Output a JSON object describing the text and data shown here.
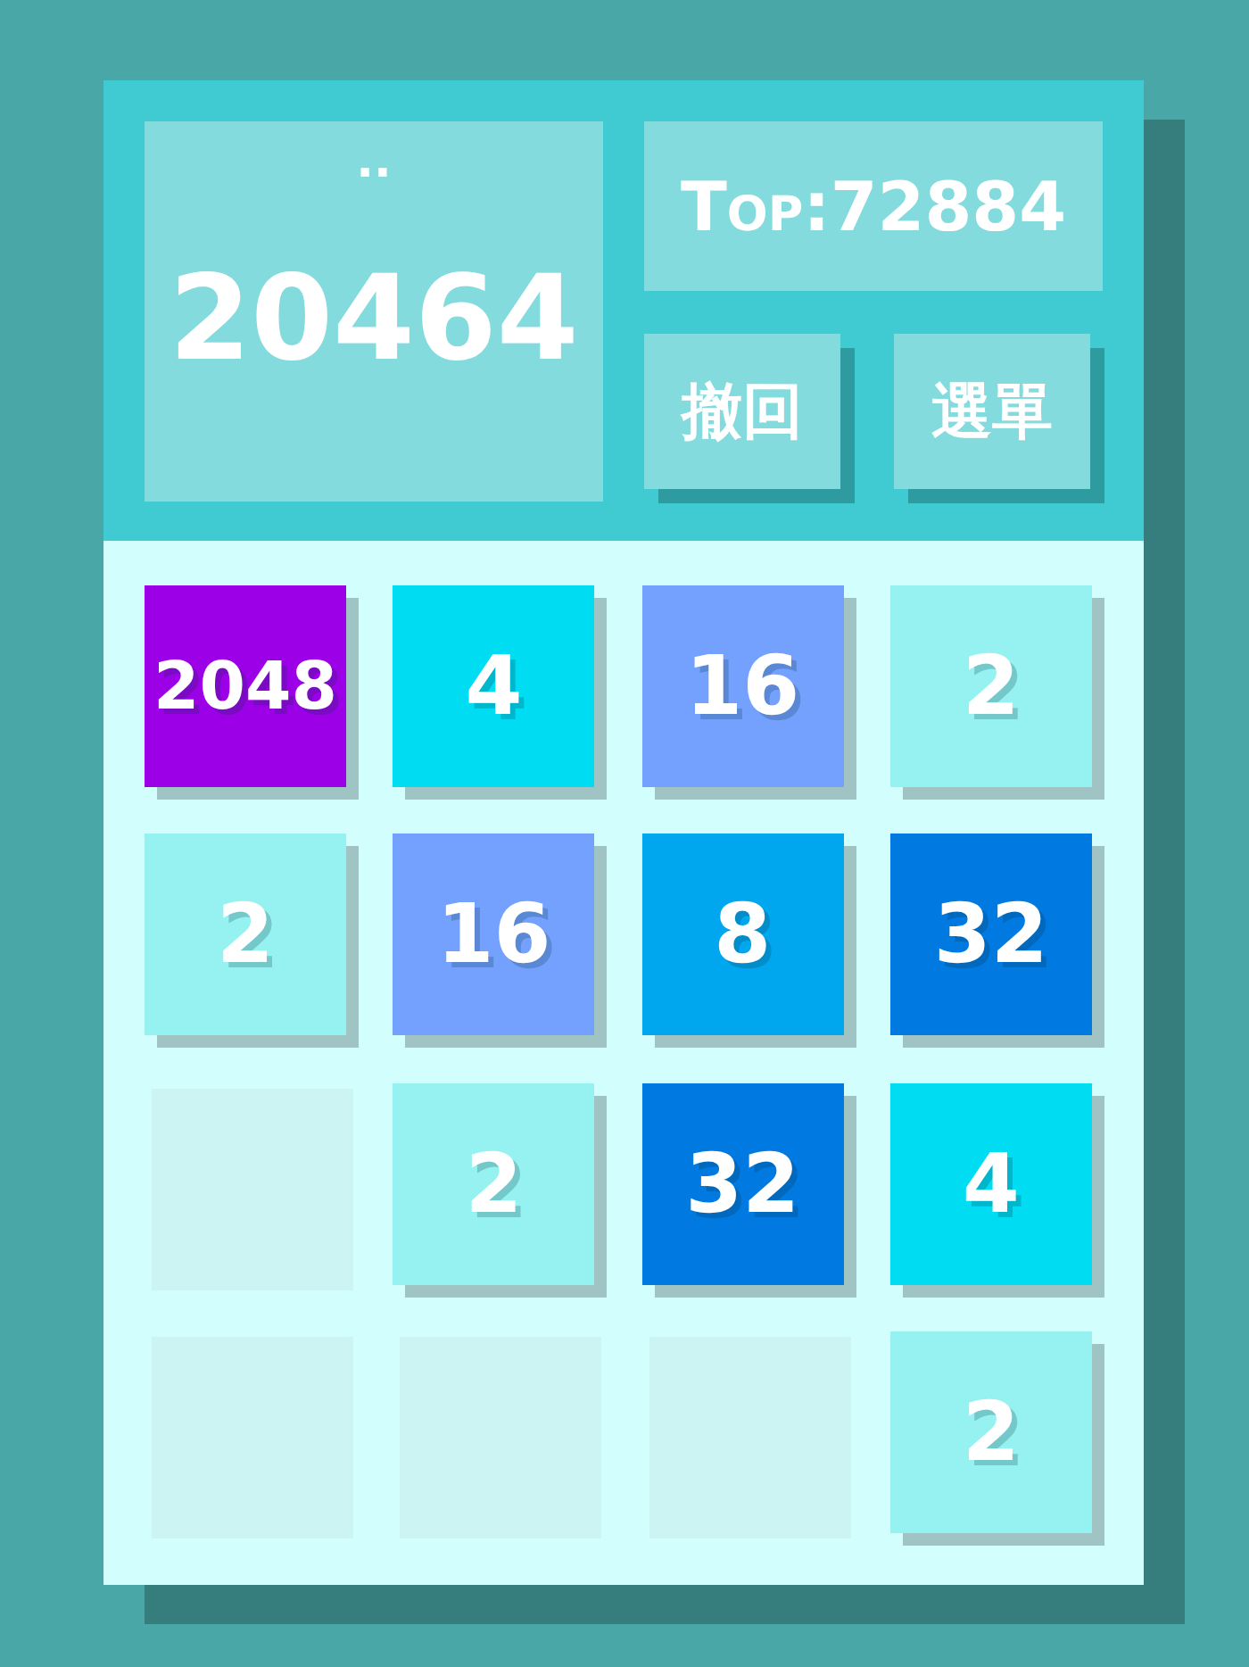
{
  "score_panel": {
    "label": "..",
    "score": "20464"
  },
  "top_score": "Top:72884",
  "buttons": [
    {
      "label": "撤回"
    },
    {
      "label": "選單"
    }
  ],
  "board": {
    "rows": [
      [
        {
          "kind": "tile",
          "value": "2048",
          "color": "#9b00e6"
        },
        {
          "kind": "tile",
          "value": "4",
          "color": "#00dcf2"
        },
        {
          "kind": "tile",
          "value": "16",
          "color": "#74a1fe"
        },
        {
          "kind": "tile",
          "value": "2",
          "color": "#95f2f0"
        }
      ],
      [
        {
          "kind": "tile",
          "value": "2",
          "color": "#95f2f0"
        },
        {
          "kind": "tile",
          "value": "16",
          "color": "#74a1fe"
        },
        {
          "kind": "tile",
          "value": "8",
          "color": "#00a7ef"
        },
        {
          "kind": "tile",
          "value": "32",
          "color": "#0079e1"
        }
      ],
      [
        {
          "kind": "empty"
        },
        {
          "kind": "tile",
          "value": "2",
          "color": "#95f2f0"
        },
        {
          "kind": "tile",
          "value": "32",
          "color": "#0079e1"
        },
        {
          "kind": "tile",
          "value": "4",
          "color": "#00dcf2"
        }
      ],
      [
        {
          "kind": "empty"
        },
        {
          "kind": "empty"
        },
        {
          "kind": "empty"
        },
        {
          "kind": "tile",
          "value": "2",
          "color": "#95f2f0"
        }
      ]
    ]
  }
}
